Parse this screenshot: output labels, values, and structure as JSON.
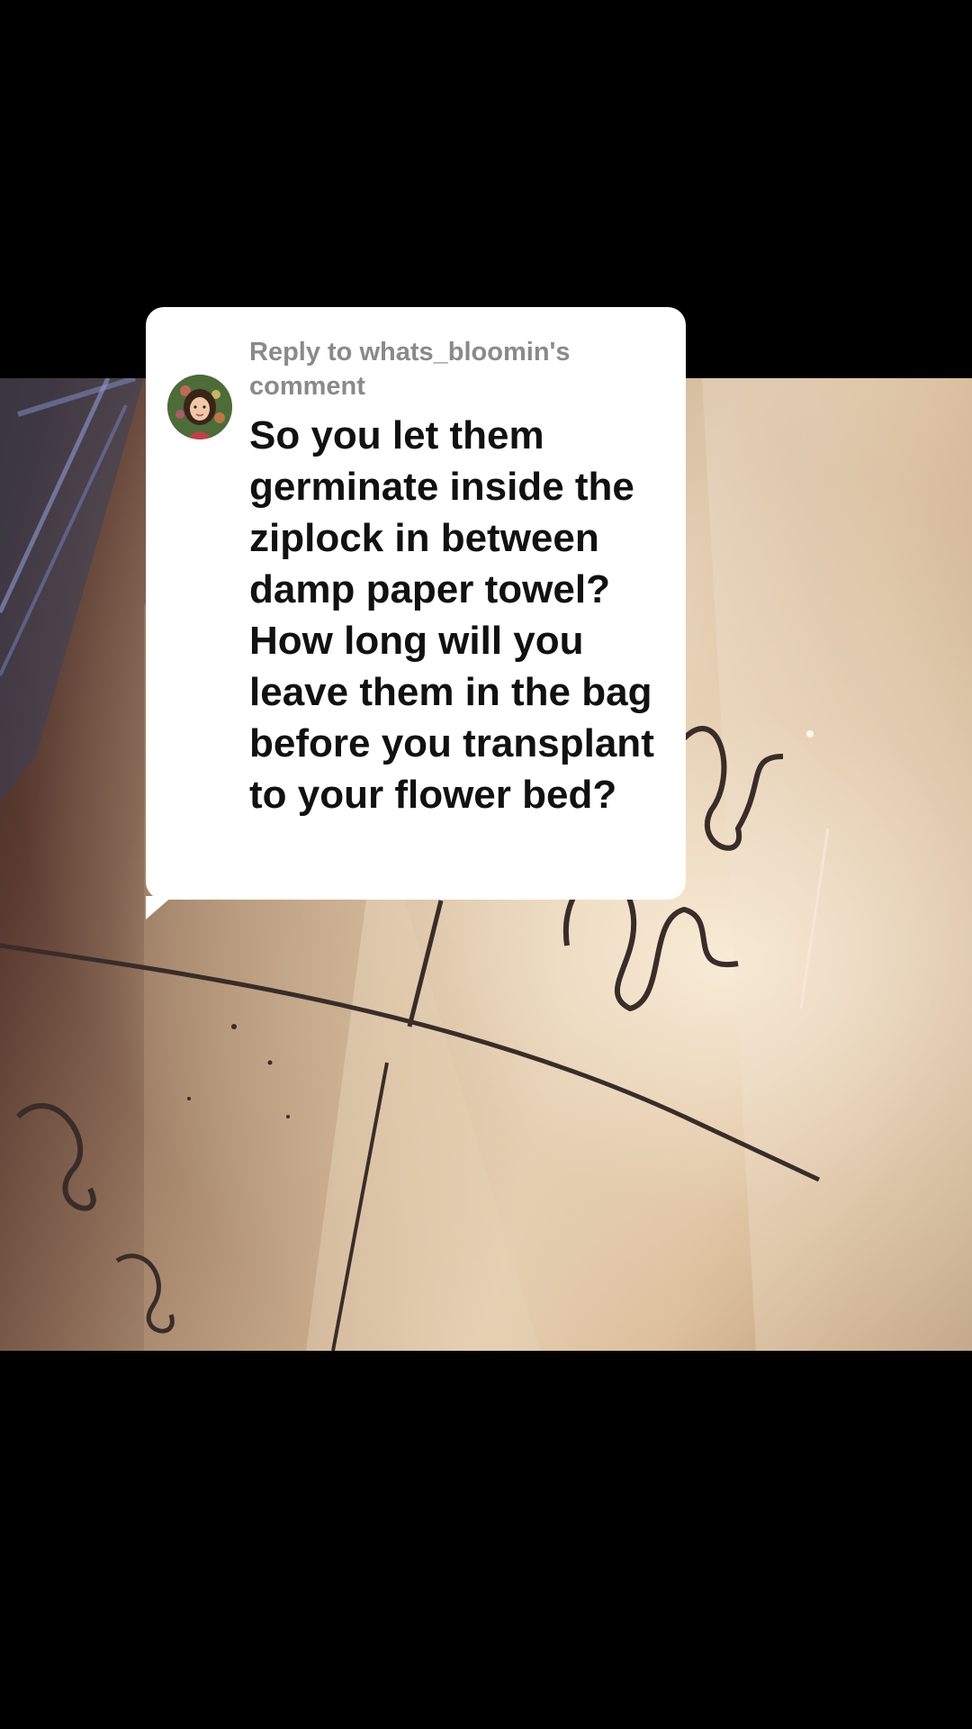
{
  "reply_card": {
    "header": "Reply to whats_bloomin's comment",
    "comment_text": "So you let them germinate inside the ziplock in between damp paper towel? How long will you leave them in the bag before you transplant to your flower bed?",
    "avatar_icon": "user-avatar-icon"
  },
  "video": {
    "description_icon": "video-frame"
  },
  "colors": {
    "background": "#000000",
    "bubble": "#ffffff",
    "header_text": "#8a8a8a",
    "body_text": "#111111"
  }
}
